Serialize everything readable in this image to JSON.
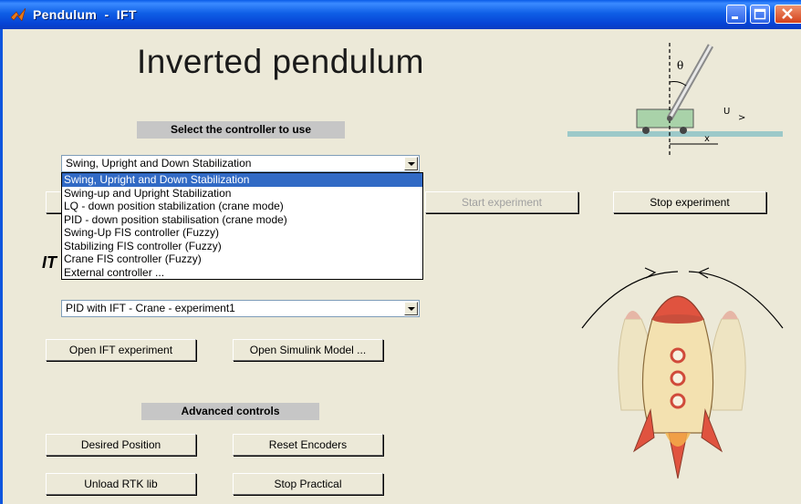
{
  "window": {
    "title": "Pendulum  -  IFT",
    "controls": [
      "minimize",
      "maximize",
      "close"
    ],
    "icon": "matlab-icon"
  },
  "main_title": "Inverted pendulum",
  "controller_section": {
    "label": "Select the controller to use",
    "selected": "Swing, Upright and Down Stabilization",
    "options": [
      "Swing, Upright and Down Stabilization",
      "Swing-up and Upright Stabilization",
      "LQ - down position stabilization (crane mode)",
      "PID - down position stabilisation (crane mode)",
      "Swing-Up FIS controller (Fuzzy)",
      "Stabilizing FIS controller (Fuzzy)",
      "Crane FIS controller (Fuzzy)",
      "External controller ..."
    ],
    "highlighted_index": 0
  },
  "experiment_buttons": {
    "start": "Start experiment",
    "stop": "Stop experiment"
  },
  "ift_section": {
    "partial_label": "IT",
    "selected": "PID with IFT - Crane  -  experiment1",
    "open_ift": "Open IFT experiment",
    "open_simulink": "Open Simulink Model ..."
  },
  "advanced": {
    "label": "Advanced controls",
    "desired_position": "Desired Position",
    "reset_encoders": "Reset Encoders",
    "unload_rtk": "Unload RTK lib",
    "stop_practical": "Stop Practical"
  },
  "diagram_labels": {
    "theta": "θ",
    "u": "U",
    "x": "x"
  },
  "colors": {
    "titlebar": "#0a5ce8",
    "face": "#ece9d8",
    "selection": "#316ac5",
    "label_bg": "#c6c6c6"
  }
}
